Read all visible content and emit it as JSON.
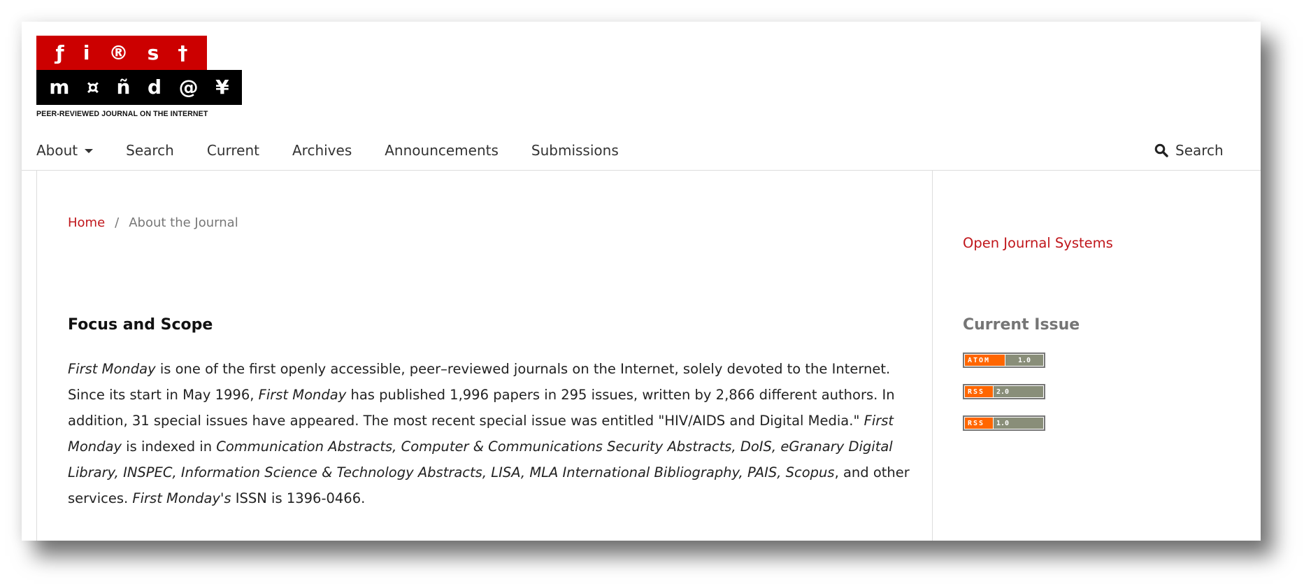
{
  "logo": {
    "top_glyphs": [
      "ƒ",
      "i",
      "®",
      "s",
      "†"
    ],
    "bottom_glyphs": [
      "m",
      "¤",
      "ñ",
      "d",
      "@",
      "¥"
    ],
    "tagline": "PEER-REVIEWED JOURNAL ON THE INTERNET",
    "colors": {
      "red": "#cc0000",
      "black": "#000000"
    }
  },
  "nav": {
    "items": [
      {
        "label": "About",
        "has_dropdown": true
      },
      {
        "label": "Search"
      },
      {
        "label": "Current"
      },
      {
        "label": "Archives"
      },
      {
        "label": "Announcements"
      },
      {
        "label": "Submissions"
      }
    ],
    "search": {
      "icon": "search-icon",
      "label": "Search"
    }
  },
  "breadcrumb": {
    "home": "Home",
    "separator": "/",
    "current": "About the Journal"
  },
  "main": {
    "section_title": "Focus and Scope",
    "paragraph": [
      {
        "t": "First Monday",
        "i": true
      },
      {
        "t": " is one of the first openly accessible, peer–reviewed journals on the Internet, solely devoted to the Internet. Since its start in May 1996, "
      },
      {
        "t": "First Monday",
        "i": true
      },
      {
        "t": " has published 1,996 papers in 295 issues, written by 2,866 different authors. In addition, 31 special issues have appeared. The most recent special issue was entitled \"HIV/AIDS and Digital Media.\" "
      },
      {
        "t": "First Monday",
        "i": true
      },
      {
        "t": " is indexed in "
      },
      {
        "t": "Communication Abstracts, Computer & Communications Security Abstracts, DoIS, eGranary Digital Library, INSPEC, Information Science & Technology Abstracts, LISA, MLA International Bibliography, PAIS, Scopus",
        "i": true
      },
      {
        "t": ", and other services. "
      },
      {
        "t": "First Monday's",
        "i": true
      },
      {
        "t": " ISSN is 1396-0466."
      }
    ]
  },
  "sidebar": {
    "ojs_link": "Open Journal Systems",
    "current_issue_title": "Current Issue",
    "feeds": [
      {
        "type": "ATOM",
        "version": "1.0"
      },
      {
        "type": "RSS",
        "version": "2.0"
      },
      {
        "type": "RSS",
        "version": "1.0"
      }
    ]
  },
  "colors": {
    "link_red": "#c0161b",
    "feed_orange": "#ff6600",
    "feed_gray": "#898e79"
  }
}
